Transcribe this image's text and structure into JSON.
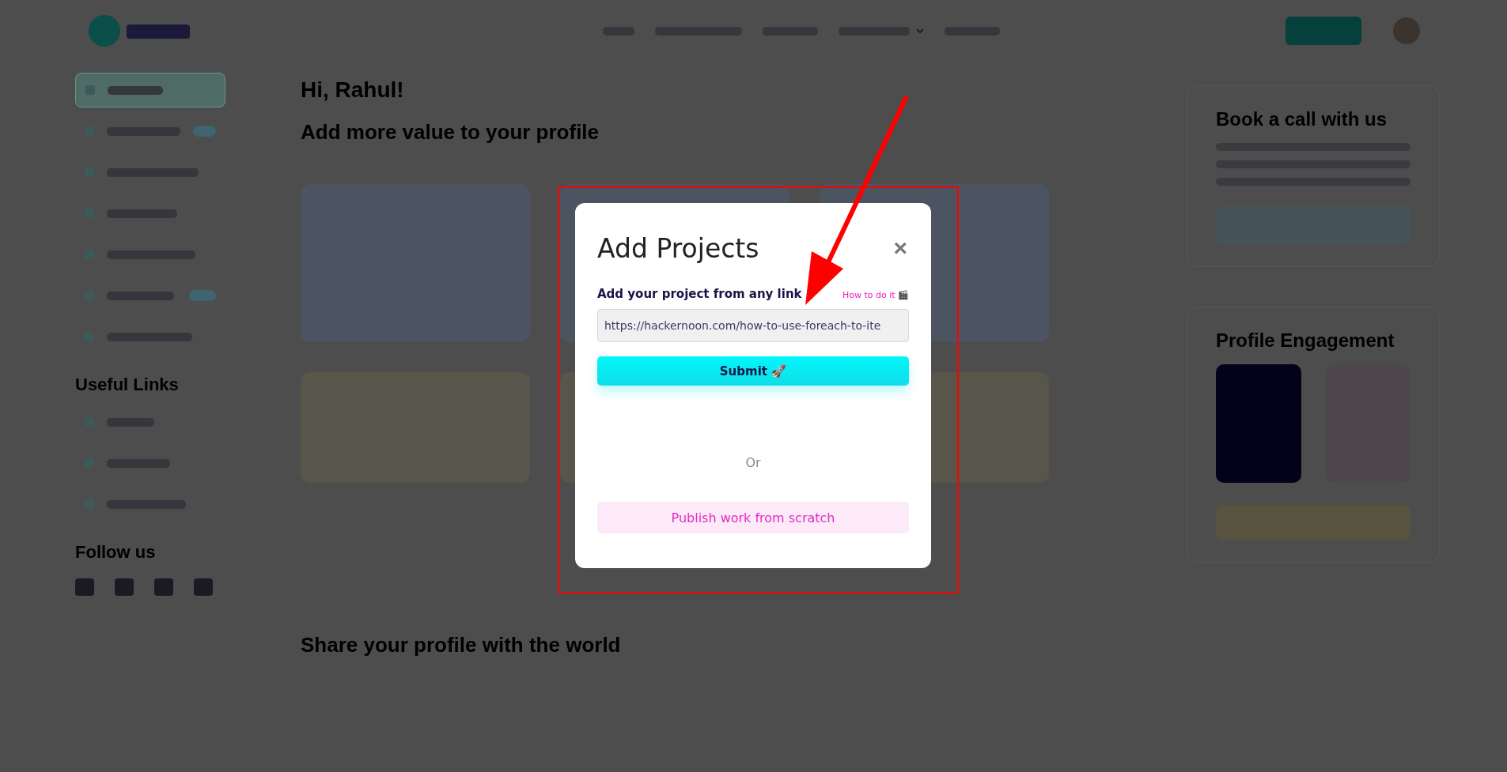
{
  "sidebar": {
    "items": [
      {
        "selected": true,
        "badge": false
      },
      {
        "selected": false,
        "badge": true
      },
      {
        "selected": false,
        "badge": false
      },
      {
        "selected": false,
        "badge": false
      },
      {
        "selected": false,
        "badge": false
      },
      {
        "selected": false,
        "badge": true
      },
      {
        "selected": false,
        "badge": false
      }
    ],
    "links_title": "Useful Links",
    "follow_title": "Follow us"
  },
  "main": {
    "greeting": "Hi, Rahul!",
    "subtitle": "Add more value to your profile",
    "share_title": "Share your profile with the world"
  },
  "right": {
    "call_title": "Book a call with us",
    "engagement_title": "Profile Engagement"
  },
  "modal": {
    "title": "Add Projects",
    "close": "×",
    "label": "Add your project from any link",
    "help_link": "How to do it 🎬",
    "url_value": "https://hackernoon.com/how-to-use-foreach-to-ite",
    "submit": "Submit 🚀",
    "separator": "Or",
    "scratch_button": "Publish work from scratch"
  }
}
